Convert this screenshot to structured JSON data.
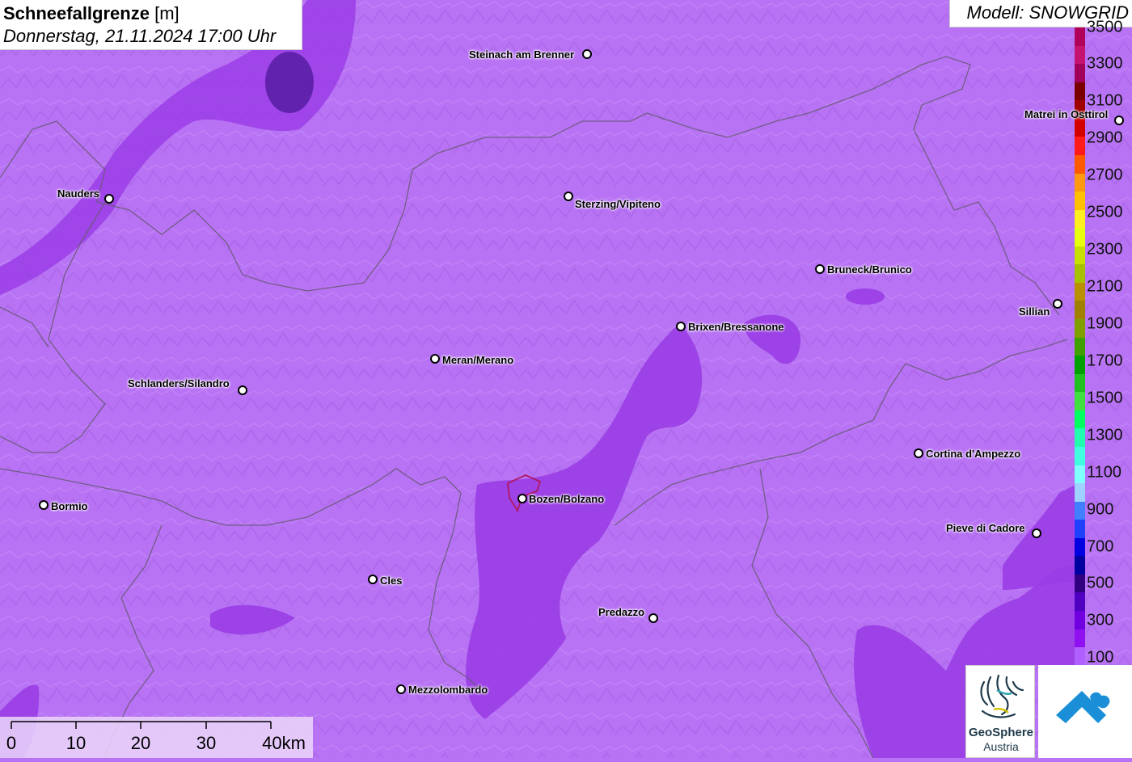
{
  "title": {
    "main": "Schneefallgrenze",
    "unit": "[m]",
    "datetime": "Donnerstag, 21.11.2024 17:00 Uhr"
  },
  "model": "Modell: SNOWGRID",
  "legend": {
    "labels": [
      "3500",
      "3300",
      "3100",
      "2900",
      "2700",
      "2500",
      "2300",
      "2100",
      "1900",
      "1700",
      "1500",
      "1300",
      "1100",
      "900",
      "700",
      "500",
      "300",
      "100"
    ],
    "colors": [
      "#b0005a",
      "#c41470",
      "#a0005a",
      "#7a0000",
      "#a00000",
      "#d40000",
      "#ff1a1a",
      "#ff5a00",
      "#ff9a10",
      "#ffc000",
      "#ffee20",
      "#e8ff10",
      "#c8e000",
      "#a8c000",
      "#b89000",
      "#a08000",
      "#80a000",
      "#40a000",
      "#00a000",
      "#20c020",
      "#40e040",
      "#00ff60",
      "#20ffb0",
      "#40ffe0",
      "#80ffff",
      "#a0d0ff",
      "#4080ff",
      "#2040ff",
      "#0000e0",
      "#0000a0",
      "#300080",
      "#5000c0",
      "#7000e0",
      "#9010f0",
      "#b060ff"
    ]
  },
  "cities": [
    {
      "name": "Steinach am Brenner"
    },
    {
      "name": "Matrei in Osttirol"
    },
    {
      "name": "Nauders"
    },
    {
      "name": "Sterzing/Vipiteno"
    },
    {
      "name": "Bruneck/Brunico"
    },
    {
      "name": "Sillian"
    },
    {
      "name": "Brixen/Bressanone"
    },
    {
      "name": "Meran/Merano"
    },
    {
      "name": "Schlanders/Silandro"
    },
    {
      "name": "Cortina d'Ampezzo"
    },
    {
      "name": "Bormio"
    },
    {
      "name": "Bozen/Bolzano"
    },
    {
      "name": "Pieve di Cadore"
    },
    {
      "name": "Cles"
    },
    {
      "name": "Predazzo"
    },
    {
      "name": "Mezzolombardo"
    }
  ],
  "scalebar": {
    "labels": [
      "0",
      "10",
      "20",
      "30",
      "40km"
    ]
  },
  "logos": {
    "geosphere_name": "GeoSphere",
    "geosphere_sub": "Austria"
  },
  "colors": {
    "background": "#b873f4",
    "darker_zone": "#9a3de6",
    "darkest_zone": "#6a1fb8",
    "borders": "#6b5a7a"
  }
}
